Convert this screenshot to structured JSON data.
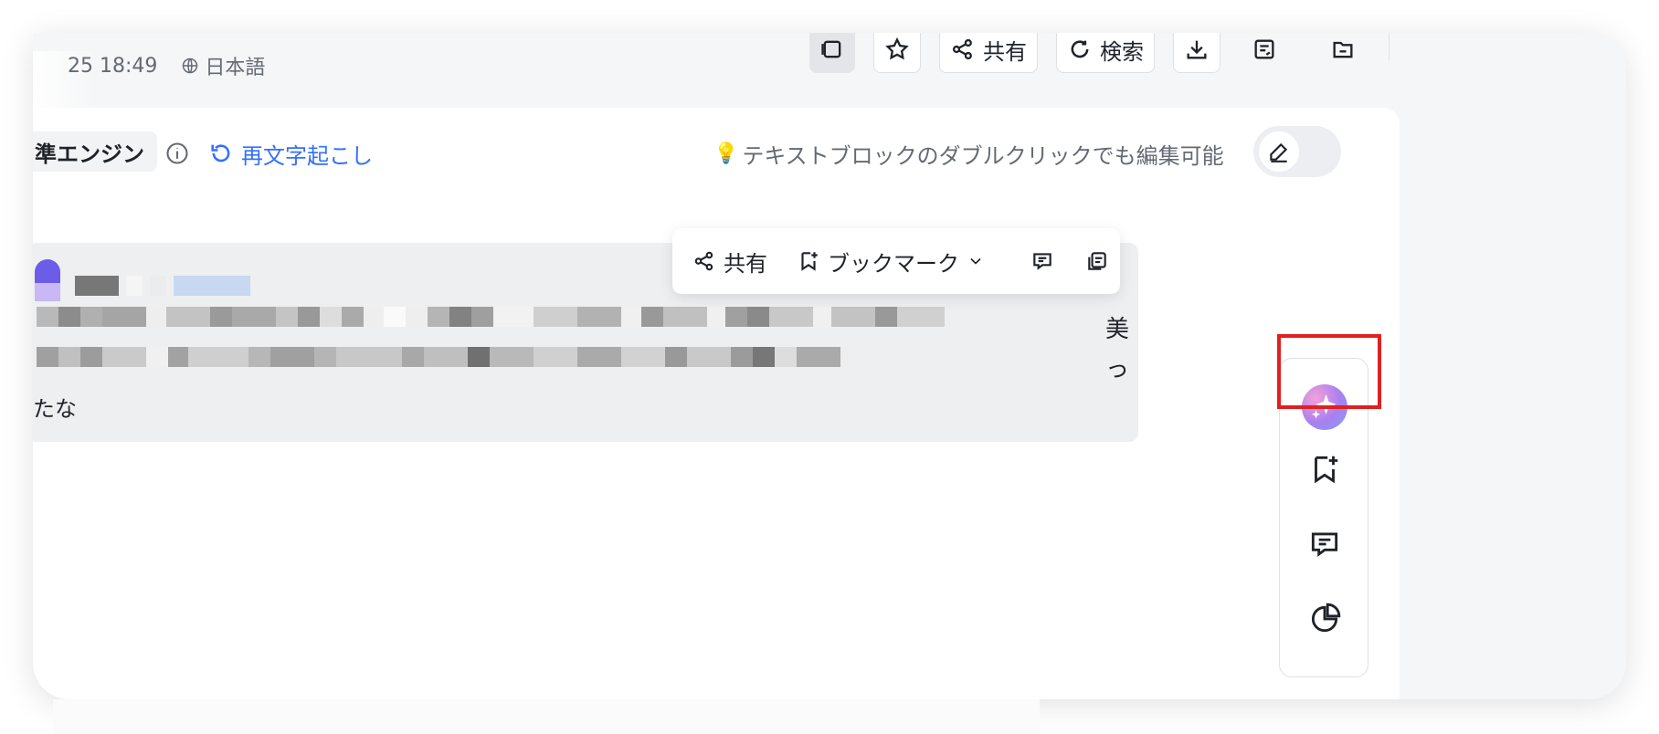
{
  "header": {
    "datetime": "25 18:49",
    "language": "日本語"
  },
  "toolbar": {
    "share_label": "共有",
    "search_label": "検索"
  },
  "panel": {
    "engine_label": "準エンジン",
    "retranscribe_label": "再文字起こし",
    "hint_text": "テキストブロックのダブルクリックでも編集可能"
  },
  "block": {
    "tail_chars": [
      "美",
      "っ"
    ],
    "last_line": "たな"
  },
  "actionbar": {
    "share_label": "共有",
    "bookmark_label": "ブックマーク"
  },
  "rail": {
    "items": [
      "ai-assistant",
      "add-bookmark",
      "comment",
      "statistics"
    ]
  },
  "colors": {
    "accent": "#3370ff",
    "highlight": "#e02020",
    "block_bg": "#eeeff1"
  }
}
